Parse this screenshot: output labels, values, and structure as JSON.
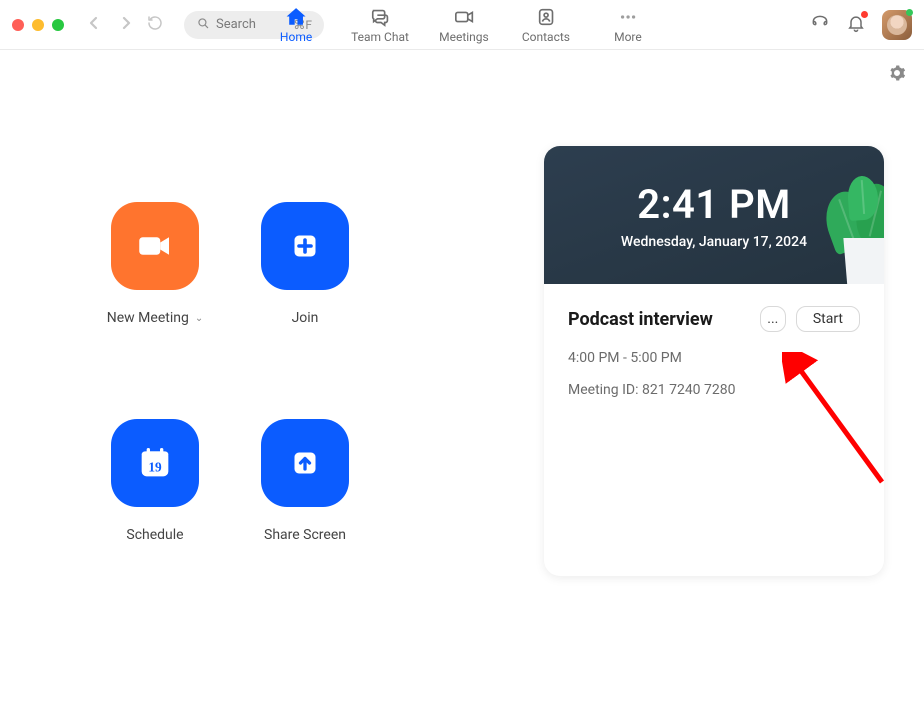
{
  "search": {
    "placeholder": "Search",
    "shortcut": "⌘F"
  },
  "tabs": {
    "home": "Home",
    "teamchat": "Team Chat",
    "meetings": "Meetings",
    "contacts": "Contacts",
    "more": "More"
  },
  "actions": {
    "new_meeting": "New Meeting",
    "join": "Join",
    "schedule": "Schedule",
    "share_screen": "Share Screen",
    "calendar_day": "19"
  },
  "clock": {
    "time": "2:41 PM",
    "date": "Wednesday, January 17, 2024"
  },
  "meeting": {
    "title": "Podcast interview",
    "time_range": "4:00 PM - 5:00 PM",
    "meeting_id_label": "Meeting ID:",
    "meeting_id": "821 7240 7280",
    "start_label": "Start",
    "more_label": "..."
  }
}
